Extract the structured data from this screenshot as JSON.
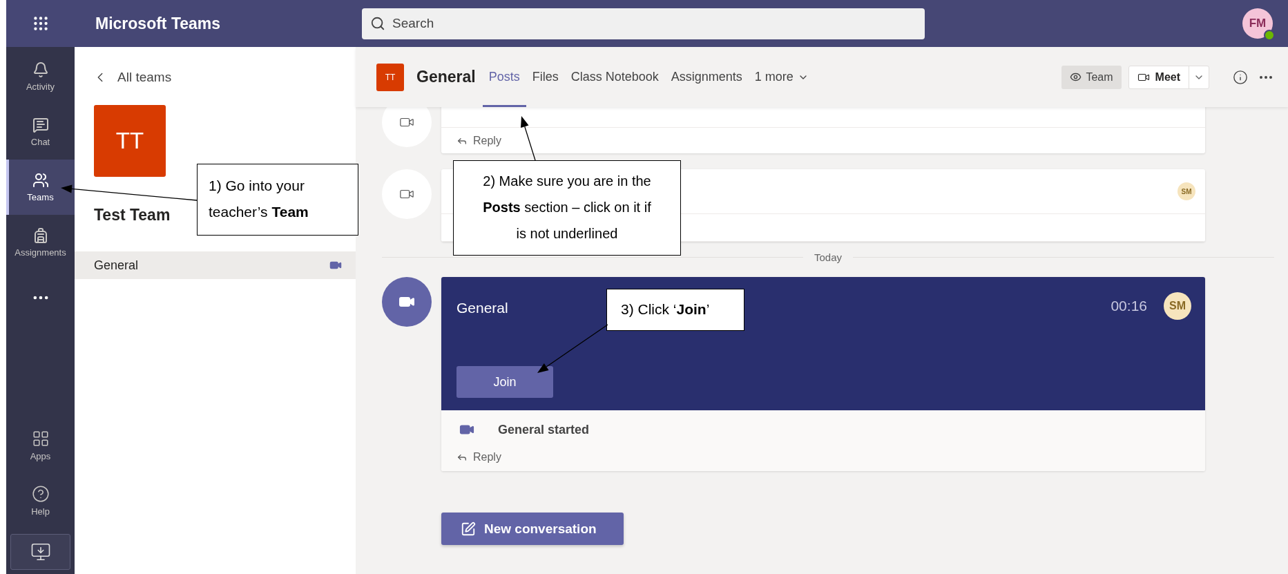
{
  "app_bar": {
    "title": "Microsoft Teams",
    "search": {
      "placeholder": "Search"
    },
    "avatar": "FM"
  },
  "rail": {
    "top": [
      {
        "label": "Activity",
        "selected": false
      },
      {
        "label": "Chat",
        "selected": false
      },
      {
        "label": "Teams",
        "selected": true
      },
      {
        "label": "Assignments",
        "selected": false
      }
    ],
    "bottom": [
      {
        "label": "Apps"
      },
      {
        "label": "Help"
      }
    ]
  },
  "team_panel": {
    "back": "All teams",
    "team_initials": "TT",
    "team_name": "Test Team",
    "channels": [
      {
        "name": "General",
        "selected": true,
        "meeting": true
      }
    ]
  },
  "channel": {
    "initials": "TT",
    "name": "General",
    "tabs": [
      {
        "label": "Posts",
        "selected": true
      },
      {
        "label": "Files",
        "selected": false
      },
      {
        "label": "Class Notebook",
        "selected": false
      },
      {
        "label": "Assignments",
        "selected": false
      },
      {
        "label": "1 more",
        "selected": false
      }
    ],
    "team_button": "Team",
    "meet_button": "Meet"
  },
  "earlier_posts": [
    {
      "reply": "Reply"
    },
    {
      "avatar": "SM"
    }
  ],
  "divider": "Today",
  "meeting": {
    "title": "General",
    "duration": "00:16",
    "avatar": "SM",
    "join": "Join",
    "status": "General started",
    "reply": "Reply"
  },
  "new_conversation": "New conversation",
  "annotations": [
    {
      "text": "1) Go into your teacher’s **Team**"
    },
    {
      "text": "2) Make sure you are in the **Posts** section – click on it if is not underlined"
    },
    {
      "text": "3) Click ‘**Join**’"
    }
  ]
}
